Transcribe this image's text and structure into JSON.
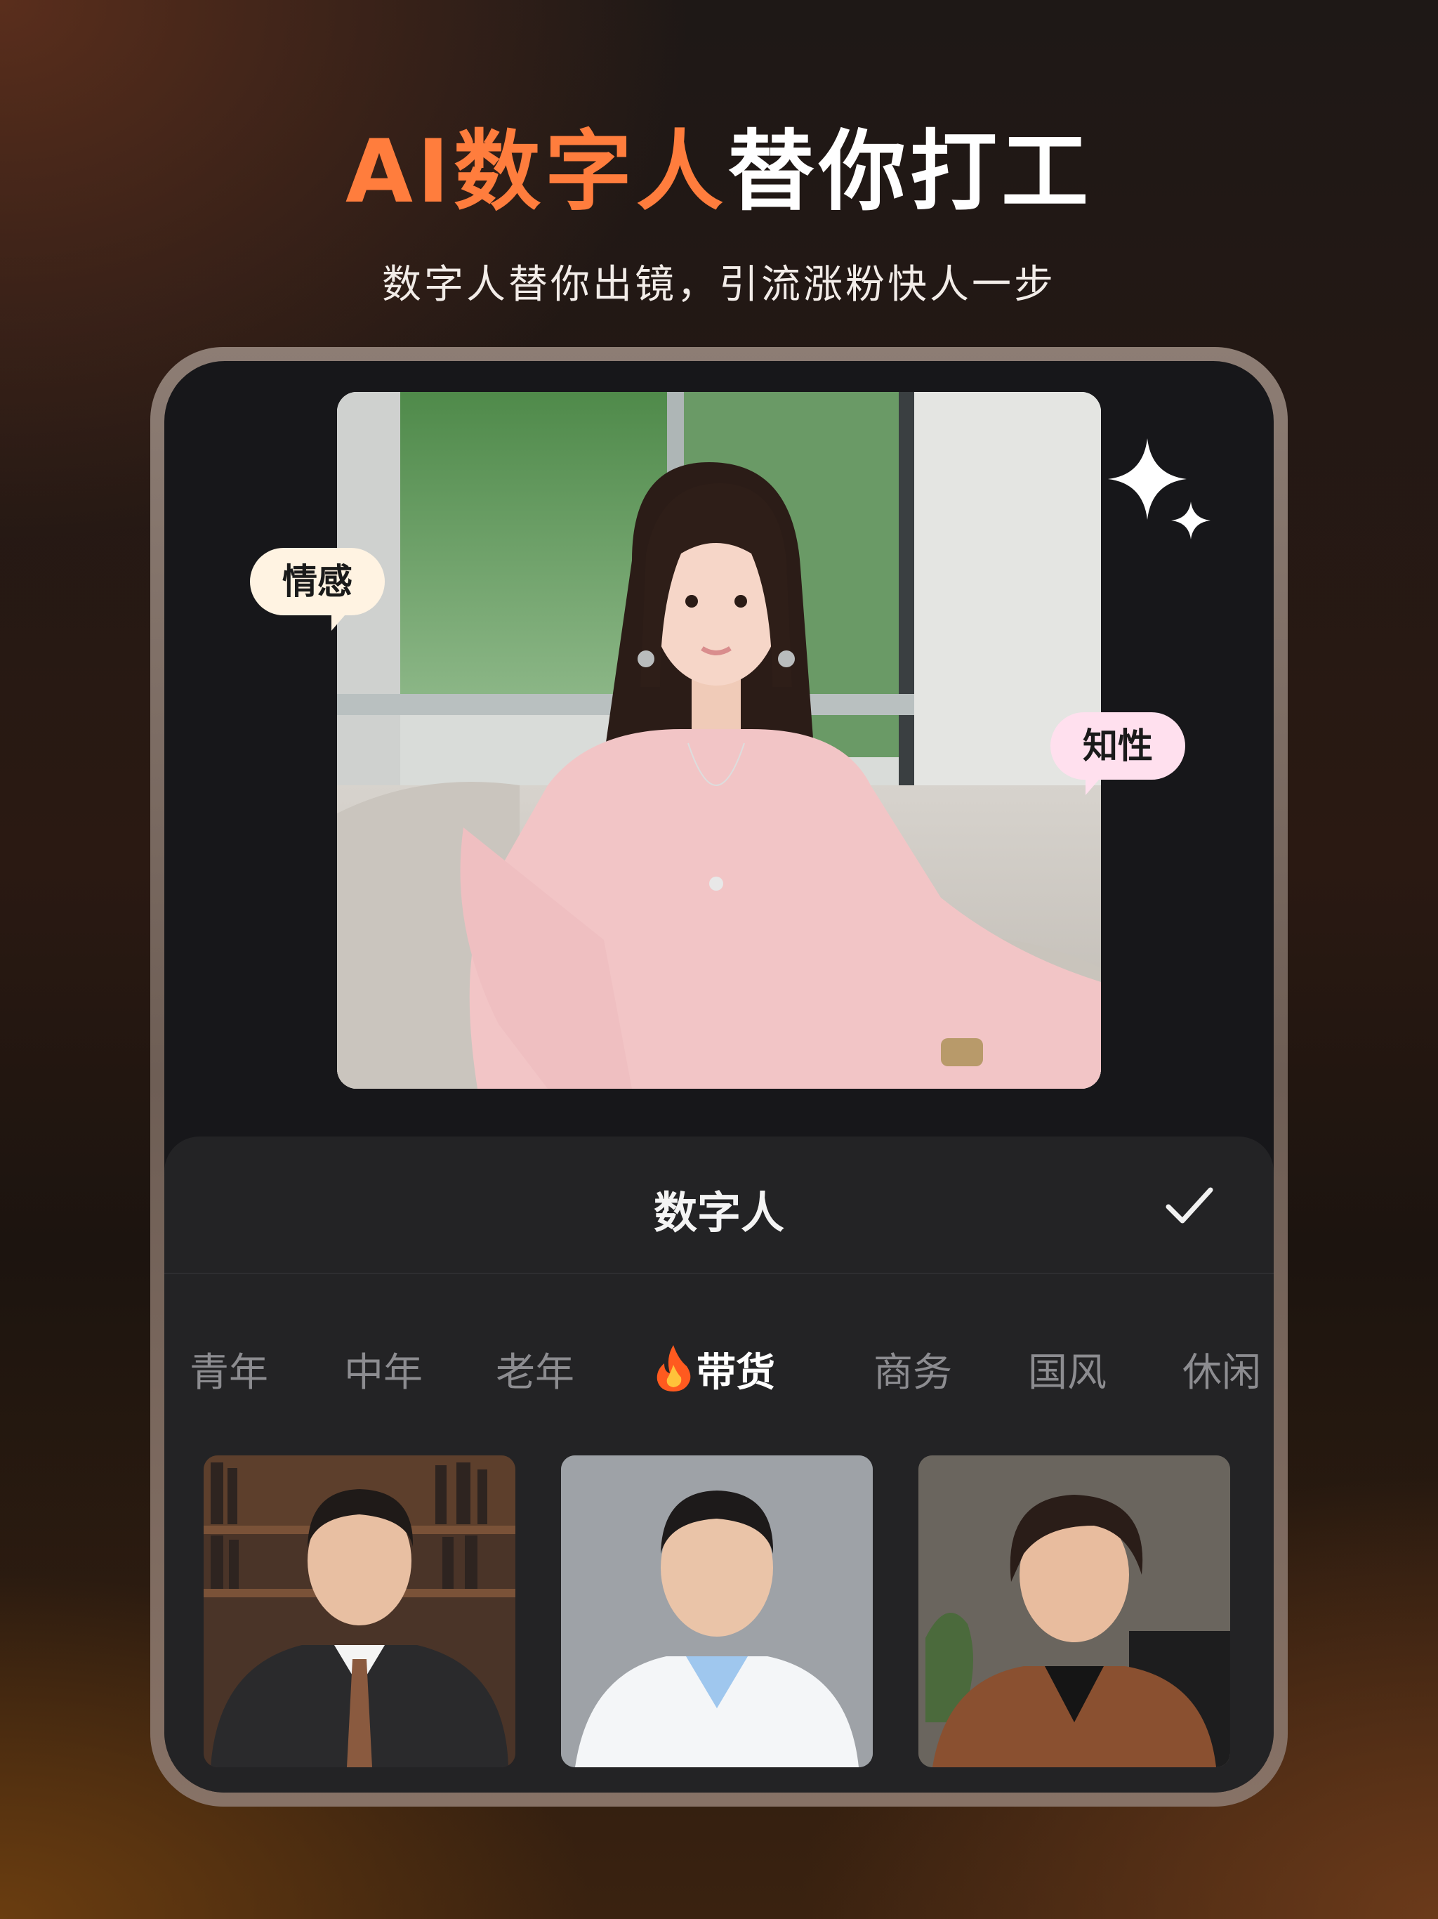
{
  "header": {
    "title_accent": "AI数字人",
    "title_rest": "替你打工",
    "subtitle": "数字人替你出镜，引流涨粉快人一步"
  },
  "hero": {
    "tags": [
      "情感",
      "知性"
    ]
  },
  "panel": {
    "title": "数字人",
    "tabs": [
      "青年",
      "中年",
      "老年",
      "带货",
      "商务",
      "国风",
      "休闲"
    ],
    "active_tab": "带货",
    "active_tab_icon": "fire-icon"
  },
  "colors": {
    "accent": "#ff7d3d",
    "panel_bg": "#232325",
    "device_bg": "#17171a",
    "tag_warm": "#fff3e2",
    "tag_pink": "#ffe0ee"
  }
}
